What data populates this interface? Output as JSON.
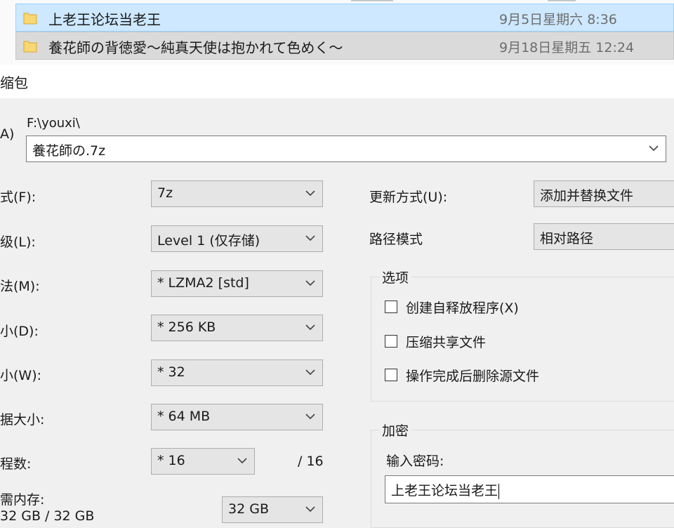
{
  "explorer": {
    "files": [
      {
        "name": "上老王论坛当老王",
        "date": "9月5日星期六 8:36",
        "selected": true
      },
      {
        "name": "養花師の背徳愛～純真天使は抱かれて色めく～",
        "date": "9月18日星期五 12:24",
        "selected": false
      }
    ]
  },
  "dialog": {
    "title": "缩包",
    "archive": {
      "label": "A)",
      "path": "F:\\youxi\\",
      "value": "養花師の.7z"
    },
    "left_fields": [
      {
        "label": "式(F):",
        "value": "7z"
      },
      {
        "label": "级(L):",
        "value": "Level 1 (仅存储)"
      },
      {
        "label": "法(M):",
        "value": "* LZMA2 [std]"
      },
      {
        "label": "小(D):",
        "value": "* 256 KB"
      },
      {
        "label": "小(W):",
        "value": "* 32"
      },
      {
        "label": "据大小:",
        "value": "* 64 MB"
      },
      {
        "label": "程数:",
        "value": "* 16",
        "suffix": "/ 16"
      }
    ],
    "memory": {
      "label": "需内存:",
      "usage": "32 GB / 32 GB",
      "value": "32 GB"
    },
    "right_fields": [
      {
        "label": "更新方式(U):",
        "value": "添加并替换文件"
      },
      {
        "label": "路径模式",
        "value": "相对路径"
      }
    ],
    "options": {
      "title": "选项",
      "items": [
        {
          "label": "创建自释放程序(X)",
          "checked": false
        },
        {
          "label": "压缩共享文件",
          "checked": false
        },
        {
          "label": "操作完成后删除源文件",
          "checked": false
        }
      ]
    },
    "encryption": {
      "title": "加密",
      "password_label": "输入密码:",
      "password_value": "上老王论坛当老王"
    }
  },
  "colors": {
    "selection": "#cde8ff",
    "selection_border": "#99d1ff",
    "dialog_bg": "#f0f0f0",
    "combo_bg": "#e5e5e5"
  }
}
